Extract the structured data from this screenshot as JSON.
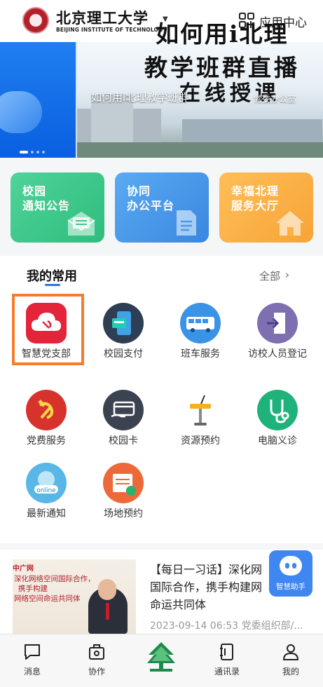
{
  "header": {
    "logo_cn": "北京理工大学",
    "logo_en": "BEIJING INSTITUTE OF TECHNOLOGY",
    "app_center": "应用中心"
  },
  "banner": {
    "headline_line1": "如何用i北理",
    "headline_line2": "教学班群直播",
    "headline_line3": "在线授课",
    "caption": "如何用i北理教学班群",
    "tag": "党委办公室",
    "active_slide": 0,
    "slide_count": 5
  },
  "quick_cards": [
    {
      "line1": "校园",
      "line2": "通知公告",
      "color": "#3cc98a",
      "icon": "envelope-icon"
    },
    {
      "line1": "协同",
      "line2": "办公平台",
      "color": "#4a98ea",
      "icon": "document-icon"
    },
    {
      "line1": "幸福北理",
      "line2": "服务大厅",
      "color": "#fbb146",
      "icon": "house-icon"
    }
  ],
  "favorites": {
    "title": "我的常用",
    "all_label": "全部",
    "apps": [
      {
        "label": "智慧党支部",
        "icon": "party-cloud-icon",
        "color": "#e3243b"
      },
      {
        "label": "校园支付",
        "icon": "payment-phone-icon",
        "color": "#2d3e55"
      },
      {
        "label": "班车服务",
        "icon": "bus-icon",
        "color": "#3a93e6"
      },
      {
        "label": "访校人员登记",
        "icon": "visitor-entry-icon",
        "color": "#7d6fb0"
      },
      {
        "label": "党费服务",
        "icon": "hammer-sickle-icon",
        "color": "#d8322d"
      },
      {
        "label": "校园卡",
        "icon": "campus-card-icon",
        "color": "#3b4250"
      },
      {
        "label": "资源预约",
        "icon": "podium-icon",
        "color": "#ffffff"
      },
      {
        "label": "电脑义诊",
        "icon": "stethoscope-icon",
        "color": "#1fb27a"
      },
      {
        "label": "最新通知",
        "icon": "online-globe-icon",
        "color": "#58b7e6"
      },
      {
        "label": "场地预约",
        "icon": "venue-booking-icon",
        "color": "#ec6a3a"
      }
    ]
  },
  "article": {
    "title": "【每日一习话】深化网络空间国际合作，携手构建网络空间命运共同体",
    "title_display": "【每日一习话】深化网国际合作，携手构建网命运共同体",
    "meta": "2023-09-14 06:53 党委组织部/...",
    "image_text_1": "中广网",
    "image_text_2": "深化网络空间国际合作，",
    "image_text_3": "携手构建",
    "image_text_4": "网络空间命运共同体",
    "assistant_label": "智慧助手"
  },
  "nav": [
    {
      "label": "消息",
      "icon": "message-icon"
    },
    {
      "label": "协作",
      "icon": "collaboration-icon"
    },
    {
      "label": "",
      "icon": "school-emblem-icon"
    },
    {
      "label": "通讯录",
      "icon": "contacts-icon"
    },
    {
      "label": "我的",
      "icon": "profile-icon"
    }
  ]
}
